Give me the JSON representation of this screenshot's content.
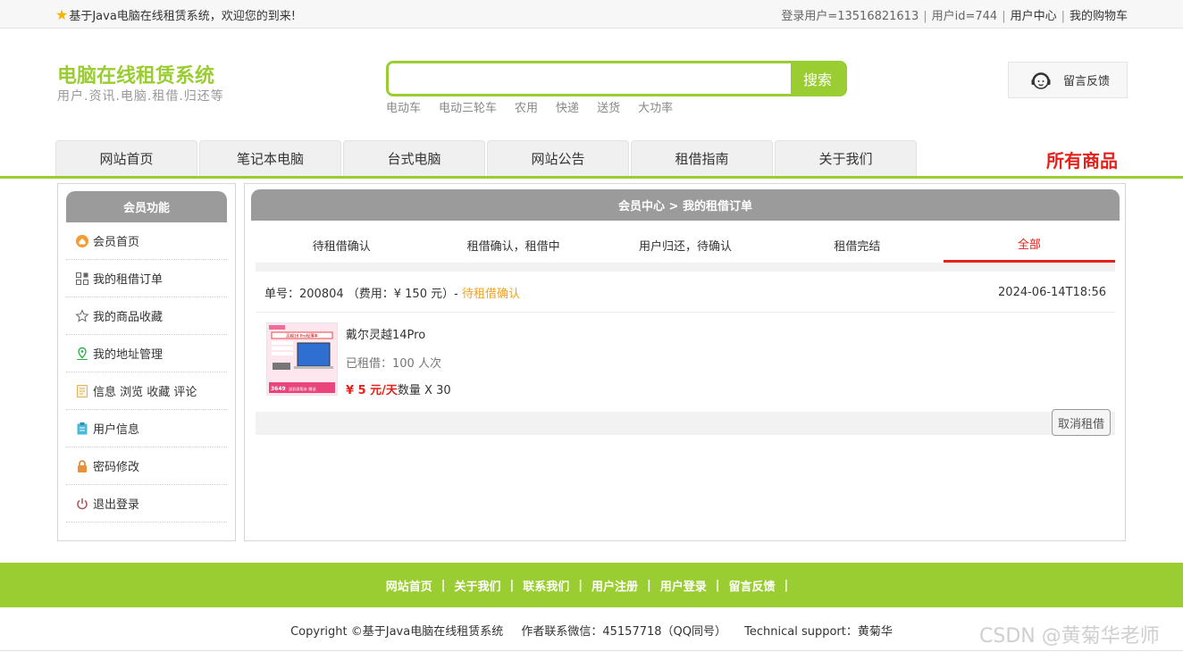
{
  "topbar": {
    "welcome": "基于Java电脑在线租赁系统，欢迎您的到来!",
    "login_user": "登录用户=13516821613",
    "user_id": "用户id=744",
    "user_center": "用户中心",
    "cart": "我的购物车"
  },
  "logo": {
    "title": "电脑在线租赁系统",
    "subtitle": "用户.资讯.电脑.租借.归还等"
  },
  "search": {
    "placeholder": "",
    "button": "搜索",
    "hot": [
      "电动车",
      "电动三轮车",
      "农用",
      "快递",
      "送货",
      "大功率"
    ]
  },
  "feedback": {
    "label": "留言反馈"
  },
  "nav": {
    "items": [
      "网站首页",
      "笔记本电脑",
      "台式电脑",
      "网站公告",
      "租借指南",
      "关于我们"
    ],
    "all_goods": "所有商品"
  },
  "sidebar": {
    "title": "会员功能",
    "items": [
      {
        "label": "会员首页",
        "icon": "home-icon"
      },
      {
        "label": "我的租借订单",
        "icon": "order-icon"
      },
      {
        "label": "我的商品收藏",
        "icon": "star-icon"
      },
      {
        "label": "我的地址管理",
        "icon": "location-icon"
      },
      {
        "label": "信息 浏览 收藏 评论",
        "icon": "document-icon"
      },
      {
        "label": "用户信息",
        "icon": "clipboard-icon"
      },
      {
        "label": "密码修改",
        "icon": "lock-icon"
      },
      {
        "label": "退出登录",
        "icon": "power-icon"
      }
    ]
  },
  "main": {
    "breadcrumb": "会员中心 > 我的租借订单",
    "tabs": [
      {
        "label": "待租借确认",
        "active": false
      },
      {
        "label": "租借确认，租借中",
        "active": false
      },
      {
        "label": "用户归还，待确认",
        "active": false
      },
      {
        "label": "租借完结",
        "active": false
      },
      {
        "label": "全部",
        "active": true
      }
    ],
    "order": {
      "number_text": "单号：200804 （费用：¥ 150 元）-",
      "status": "待租借确认",
      "datetime": "2024-06-14T18:56",
      "product_name": "戴尔灵越14Pro",
      "rented": "已租借：100 人次",
      "price": "¥ 5 元/天",
      "quantity": "数量 X 30",
      "cancel_button": "取消租借",
      "image_text": {
        "top": "灵越16 Pro轻薄本",
        "price": "3649",
        "bottom": "送彩屏版本 赠送"
      }
    }
  },
  "footer": {
    "links": [
      "网站首页",
      "关于我们",
      "联系我们",
      "用户注册",
      "用户登录",
      "留言反馈"
    ],
    "copyright": "Copyright ©基于Java电脑在线租赁系统",
    "author": "作者联系微信：45157718（QQ同号）",
    "support": "Technical support：黄菊华",
    "watermark": "CSDN @黄菊华老师"
  },
  "colors": {
    "accent_green": "#9acd32",
    "red": "#e4211b",
    "status_orange": "#f0a020"
  }
}
